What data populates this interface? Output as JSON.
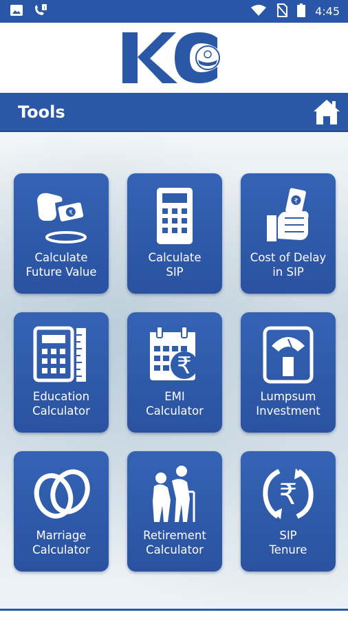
{
  "status_bar": {
    "time": "4:45",
    "icons": [
      "image-icon",
      "phone-icon",
      "wifi-icon",
      "no-sim-icon",
      "battery-icon"
    ]
  },
  "logo": {
    "text": "KC"
  },
  "toolbar": {
    "title": "Tools",
    "home_icon": "home-icon"
  },
  "tiles": [
    {
      "label": "Calculate\nFuture Value",
      "icon": "hand-coin-icon"
    },
    {
      "label": "Calculate\nSIP",
      "icon": "calculator-icon"
    },
    {
      "label": "Cost of Delay\nin SIP",
      "icon": "hand-money-icon"
    },
    {
      "label": "Education\nCalculator",
      "icon": "calculator-ruler-icon"
    },
    {
      "label": "EMI\nCalculator",
      "icon": "calendar-rupee-icon"
    },
    {
      "label": "Lumpsum\nInvestment",
      "icon": "weighing-scale-icon"
    },
    {
      "label": "Marriage\nCalculator",
      "icon": "rings-icon"
    },
    {
      "label": "Retirement\nCalculator",
      "icon": "elderly-couple-icon"
    },
    {
      "label": "SIP\nTenure",
      "icon": "rupee-cycle-icon"
    }
  ],
  "colors": {
    "primary": "#2a58a6",
    "tile": "#2f5cab",
    "white": "#ffffff"
  }
}
